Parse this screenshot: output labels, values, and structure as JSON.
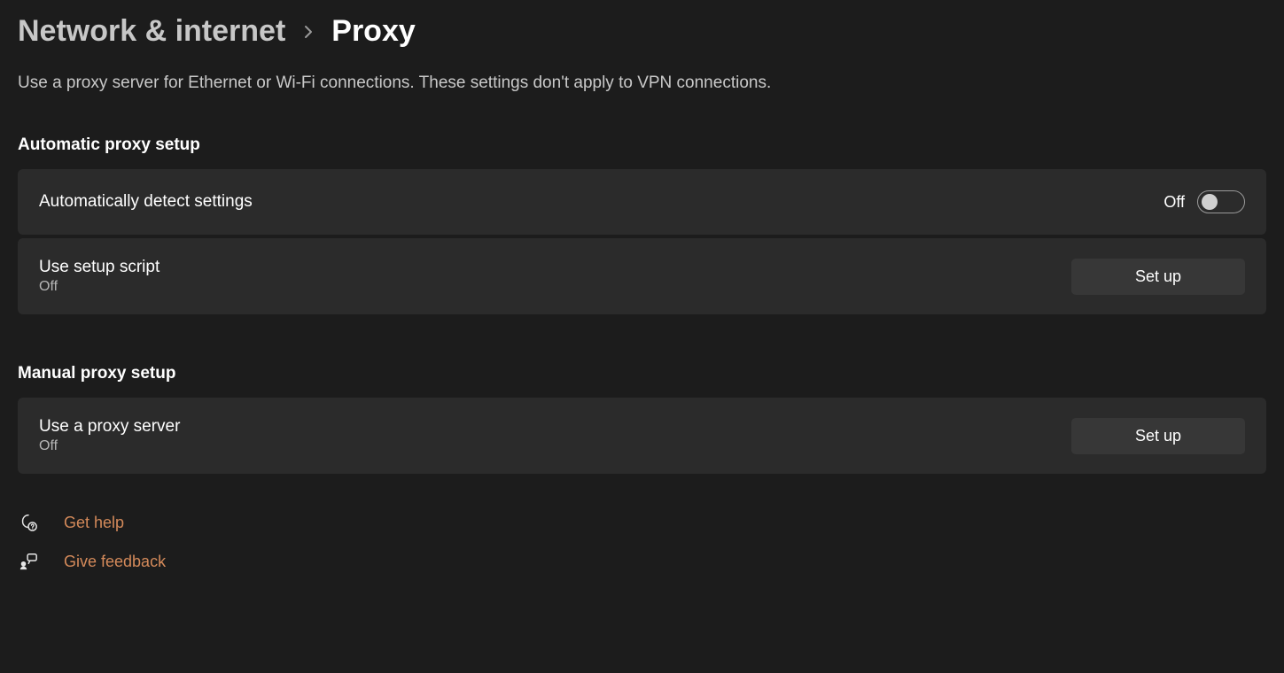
{
  "breadcrumb": {
    "parent": "Network & internet",
    "current": "Proxy"
  },
  "description": "Use a proxy server for Ethernet or Wi-Fi connections. These settings don't apply to VPN connections.",
  "sections": {
    "automatic": {
      "title": "Automatic proxy setup",
      "detect": {
        "label": "Automatically detect settings",
        "state_label": "Off"
      },
      "script": {
        "label": "Use setup script",
        "status": "Off",
        "button": "Set up"
      }
    },
    "manual": {
      "title": "Manual proxy setup",
      "server": {
        "label": "Use a proxy server",
        "status": "Off",
        "button": "Set up"
      }
    }
  },
  "footer": {
    "help": "Get help",
    "feedback": "Give feedback"
  }
}
